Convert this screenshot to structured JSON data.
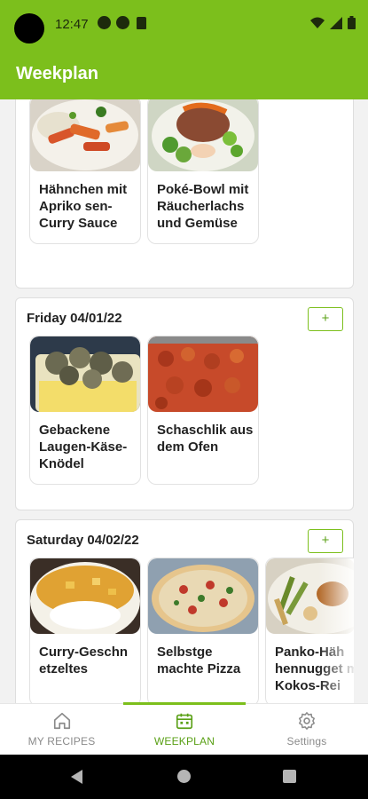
{
  "status_bar": {
    "time": "12:47"
  },
  "app_bar": {
    "title": "Weekplan"
  },
  "days": [
    {
      "title": "",
      "recipes": [
        {
          "name": "Hähnchen mit Apriko sen-Curry Sauce",
          "image": "curry-chicken-apricot-photo"
        },
        {
          "name": "Poké-Bowl mit Räucherlachs und Gemüse",
          "image": "poke-bowl-photo"
        }
      ]
    },
    {
      "title": "Friday 04/01/22",
      "add_label": "+",
      "recipes": [
        {
          "name": "Gebackene Laugen-Käse-Knödel",
          "image": "dumplings-photo"
        },
        {
          "name": "Schaschlik aus dem Ofen",
          "image": "schaschlik-photo"
        }
      ]
    },
    {
      "title": "Saturday 04/02/22",
      "add_label": "+",
      "recipes": [
        {
          "name": "Curry-Geschn etzeltes",
          "image": "curry-rice-photo"
        },
        {
          "name": "Selbstge machte Pizza",
          "image": "pizza-photo"
        },
        {
          "name": "Panko-Häh hennugget mit Kokos-Rei",
          "image": "nuggets-photo"
        }
      ]
    }
  ],
  "bottom_nav": {
    "items": [
      {
        "label": "MY RECIPES",
        "icon": "home-icon"
      },
      {
        "label": "WEEKPLAN",
        "icon": "calendar-icon"
      },
      {
        "label": "Settings",
        "icon": "gear-icon"
      }
    ],
    "active": "WEEKPLAN"
  },
  "colors": {
    "primary": "#7cbf1c",
    "primary_dark_text": "#5aa016",
    "background": "#f2f2f2"
  }
}
